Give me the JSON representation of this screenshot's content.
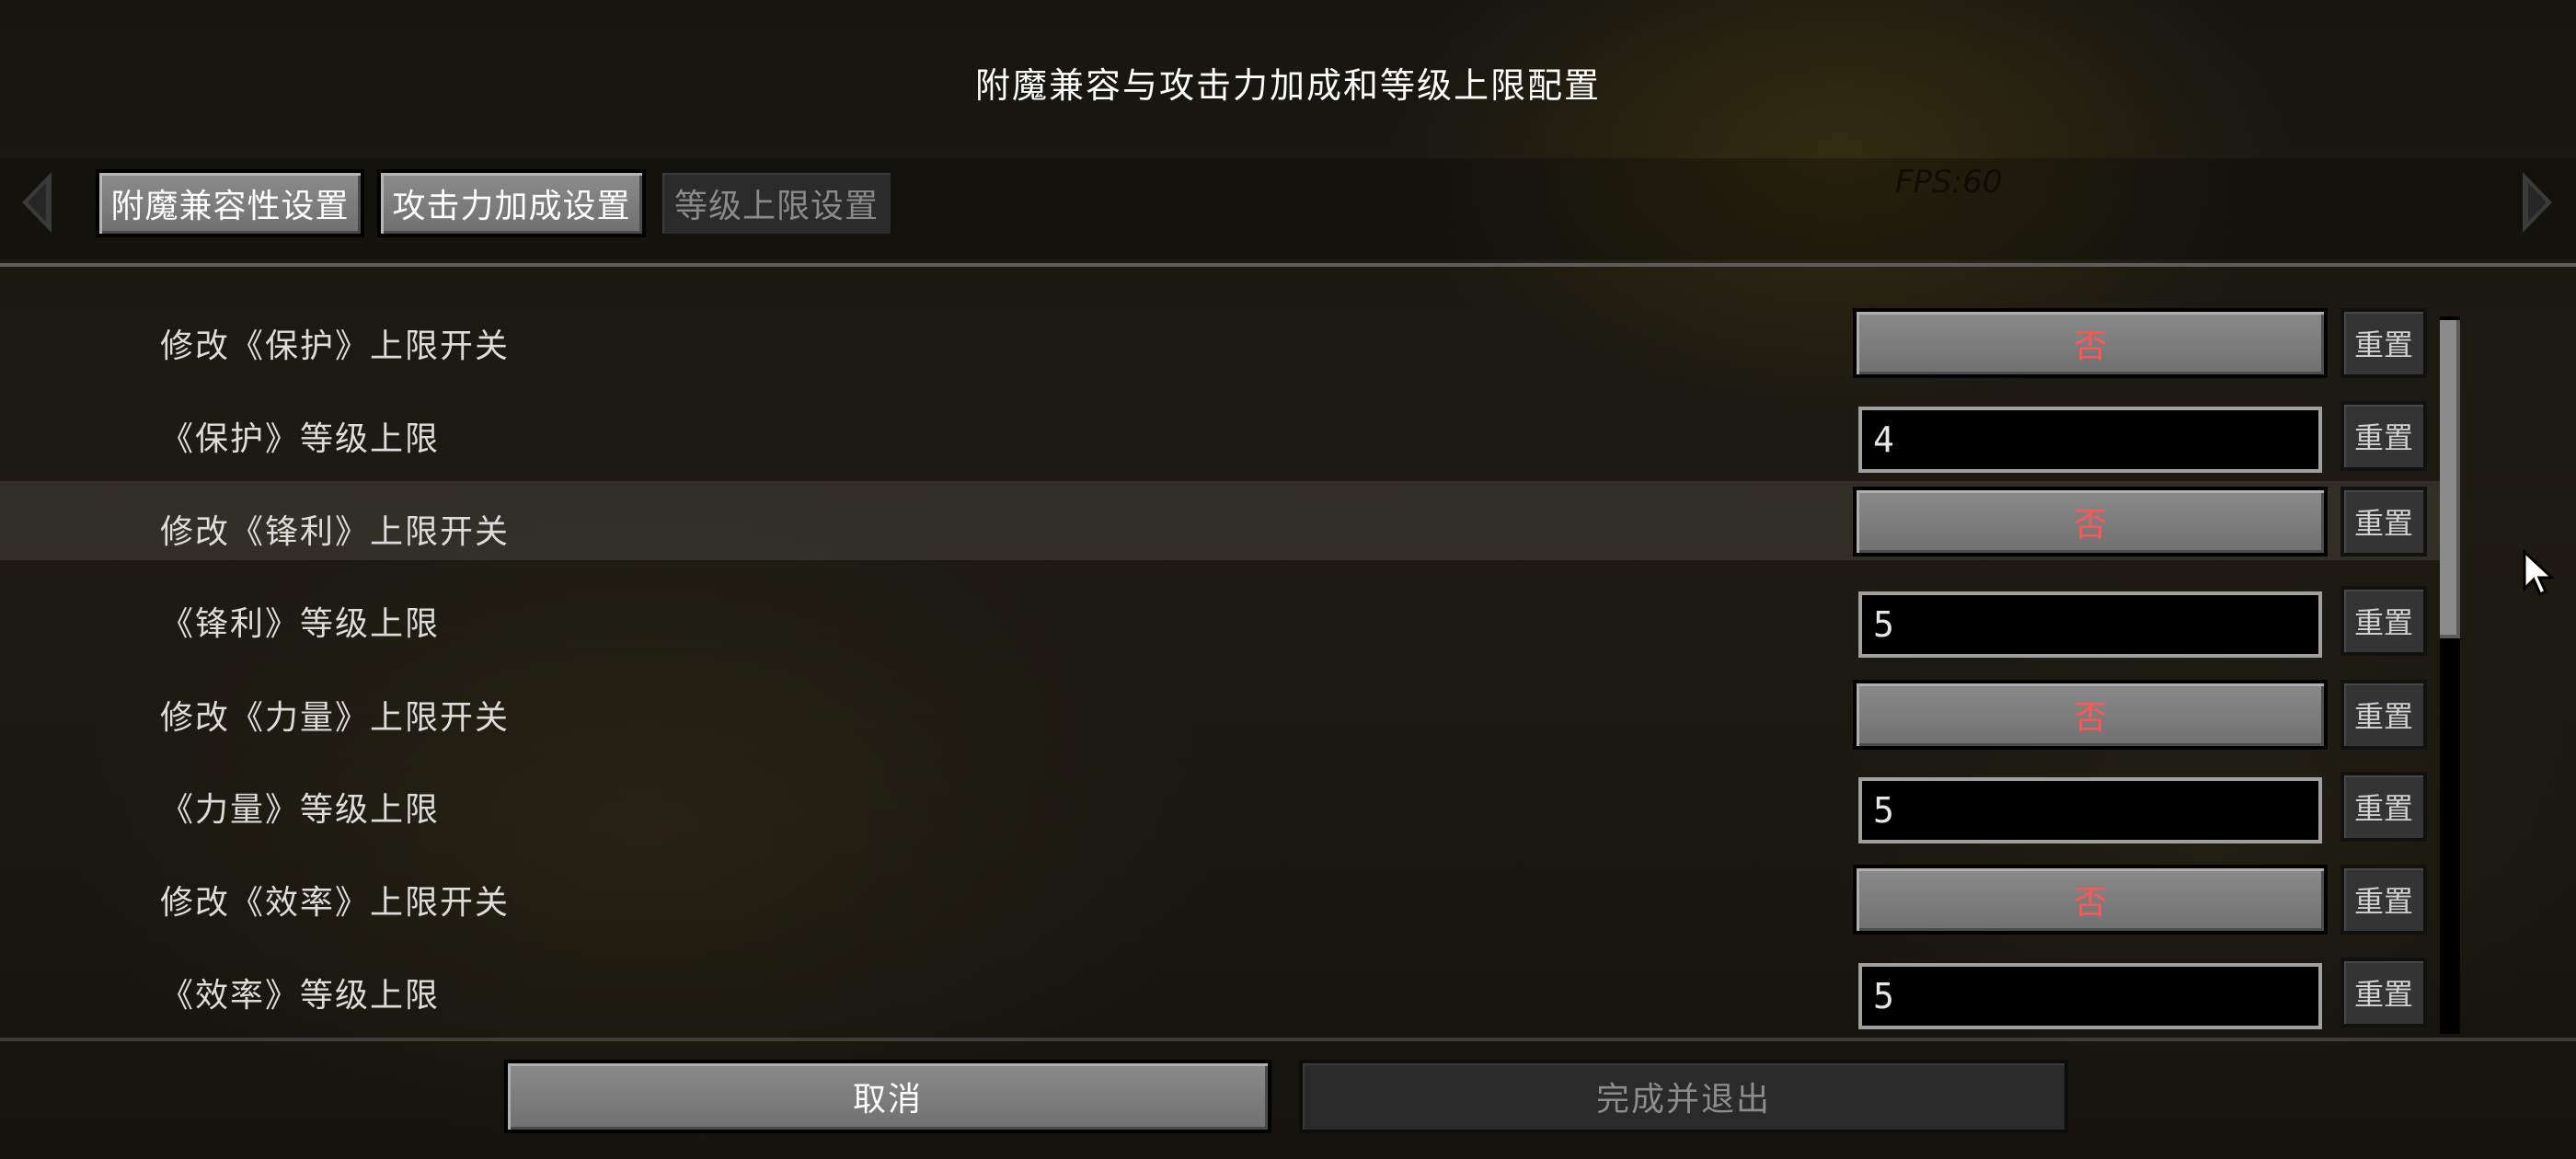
{
  "screen": {
    "title": "附魔兼容与攻击力加成和等级上限配置"
  },
  "tabs": [
    {
      "label": "附魔兼容性设置",
      "state": "active"
    },
    {
      "label": "攻击力加成设置",
      "state": "active"
    },
    {
      "label": "等级上限设置",
      "state": "disabled"
    }
  ],
  "overlay": {
    "fps": "FPS:60"
  },
  "rows": [
    {
      "label": "修改《保护》上限开关",
      "control": "toggle",
      "value": "否",
      "reset": "重置"
    },
    {
      "label": "《保护》等级上限",
      "control": "field",
      "value": "4",
      "reset": "重置"
    },
    {
      "label": "修改《锋利》上限开关",
      "control": "toggle",
      "value": "否",
      "reset": "重置"
    },
    {
      "label": "《锋利》等级上限",
      "control": "field",
      "value": "5",
      "reset": "重置"
    },
    {
      "label": "修改《力量》上限开关",
      "control": "toggle",
      "value": "否",
      "reset": "重置"
    },
    {
      "label": "《力量》等级上限",
      "control": "field",
      "value": "5",
      "reset": "重置"
    },
    {
      "label": "修改《效率》上限开关",
      "control": "toggle",
      "value": "否",
      "reset": "重置"
    },
    {
      "label": "《效率》等级上限",
      "control": "field",
      "value": "5",
      "reset": "重置"
    }
  ],
  "footer": {
    "cancel": "取消",
    "done": "完成并退出"
  },
  "colors": {
    "toggle_off_text": "#ff5555",
    "button_gray": "#7d7d7d",
    "field_bg": "#000000"
  },
  "icons": {
    "left": "chevron-left-icon",
    "right": "chevron-right-icon",
    "cursor": "mouse-cursor-icon"
  }
}
